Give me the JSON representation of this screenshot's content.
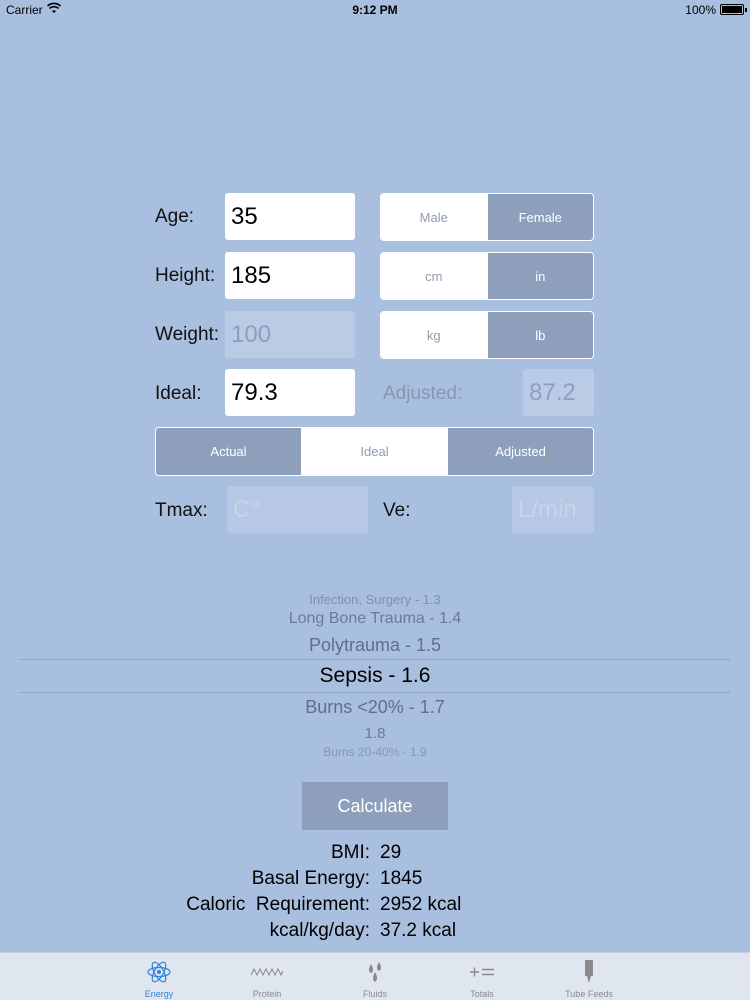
{
  "status_bar": {
    "carrier": "Carrier",
    "time": "9:12 PM",
    "battery": "100%"
  },
  "form": {
    "age": {
      "label": "Age:",
      "value": "35"
    },
    "height": {
      "label": "Height:",
      "value": "185"
    },
    "weight": {
      "label": "Weight:",
      "value": "100"
    },
    "ideal": {
      "label": "Ideal:",
      "value": "79.3"
    },
    "adjusted": {
      "label": "Adjusted:",
      "value": "87.2"
    },
    "tmax": {
      "label": "Tmax:",
      "placeholder": "C°"
    },
    "ve": {
      "label": "Ve:",
      "placeholder": "L/min"
    }
  },
  "segments": {
    "sex": {
      "options": [
        "Male",
        "Female"
      ],
      "selected": "Female"
    },
    "height_unit": {
      "options": [
        "cm",
        "in"
      ],
      "selected": "in"
    },
    "weight_unit": {
      "options": [
        "kg",
        "lb"
      ],
      "selected": "lb"
    },
    "weight_basis": {
      "options": [
        "Actual",
        "Ideal",
        "Adjusted"
      ],
      "selected": "Ideal"
    }
  },
  "stress_picker": {
    "items": [
      "Infection, Surgery - 1.3",
      "Long Bone Trauma - 1.4",
      "Polytrauma - 1.5",
      "Sepsis - 1.6",
      "Burns <20% - 1.7",
      "1.8",
      "Burns 20-40% - 1.9"
    ],
    "selected": "Sepsis - 1.6"
  },
  "calculate_label": "Calculate",
  "results": {
    "bmi": {
      "label": "BMI:",
      "value": "29"
    },
    "basal": {
      "label": "Basal Energy:",
      "value": "1845"
    },
    "caloric": {
      "label": "Caloric  Requirement:",
      "value": "2952 kcal"
    },
    "per_kg": {
      "label": "kcal/kg/day:",
      "value": "37.2 kcal"
    }
  },
  "tabs": [
    {
      "label": "Energy",
      "icon": "atom-icon",
      "active": true
    },
    {
      "label": "Protein",
      "icon": "protein-chain-icon",
      "active": false
    },
    {
      "label": "Fluids",
      "icon": "droplets-icon",
      "active": false
    },
    {
      "label": "Totals",
      "icon": "plus-equals-icon",
      "active": false
    },
    {
      "label": "Tube Feeds",
      "icon": "tube-feed-icon",
      "active": false
    }
  ],
  "colors": {
    "background": "#a9bfdf",
    "segment_selected": "#8d9fbb",
    "tab_active": "#2f82d6"
  }
}
